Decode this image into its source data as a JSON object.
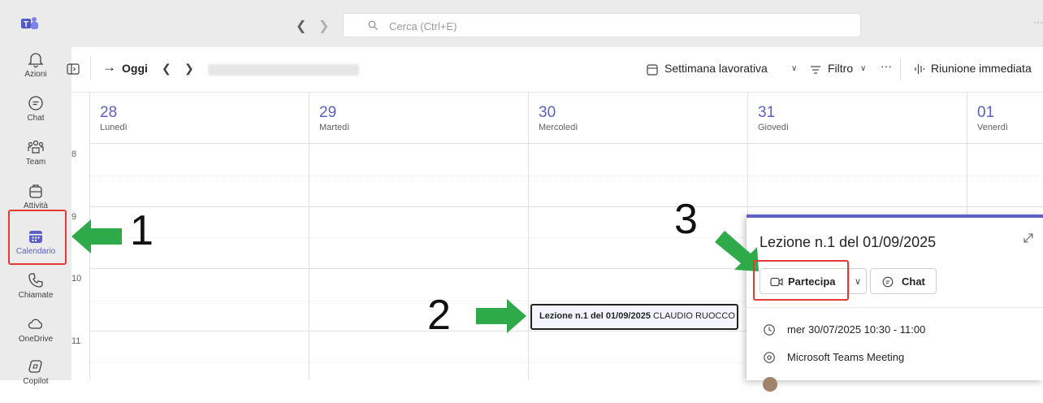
{
  "topbar": {
    "search_placeholder": "Cerca (Ctrl+E)",
    "more": "···"
  },
  "rail": {
    "items": [
      {
        "label": "Azioni",
        "icon": "bell-icon"
      },
      {
        "label": "Chat",
        "icon": "chat-icon"
      },
      {
        "label": "Team",
        "icon": "teams-icon"
      },
      {
        "label": "Attività",
        "icon": "briefcase-icon"
      },
      {
        "label": "Calendario",
        "icon": "calendar-icon",
        "active": true
      },
      {
        "label": "Chiamate",
        "icon": "phone-icon"
      },
      {
        "label": "OneDrive",
        "icon": "cloud-icon"
      },
      {
        "label": "Copilot",
        "icon": "copilot-icon"
      }
    ]
  },
  "toolbar": {
    "today": "Oggi",
    "view": "Settimana lavorativa",
    "filter": "Filtro",
    "more": "···",
    "meet_now": "Riunione immediata"
  },
  "calendar": {
    "days": [
      {
        "num": "28",
        "name": "Lunedì"
      },
      {
        "num": "29",
        "name": "Martedì"
      },
      {
        "num": "30",
        "name": "Mercoledì"
      },
      {
        "num": "31",
        "name": "Giovedì"
      },
      {
        "num": "01",
        "name": "Venerdì"
      }
    ],
    "hours": [
      "8",
      "9",
      "10",
      "11"
    ],
    "event": {
      "title": "Lezione n.1 del 01/09/2025",
      "organizer": "CLAUDIO RUOCCO"
    }
  },
  "popup": {
    "title": "Lezione n.1 del 01/09/2025",
    "join_label": "Partecipa",
    "chat_label": "Chat",
    "datetime": "mer 30/07/2025 10:30 - 11:00",
    "location": "Microsoft Teams Meeting"
  },
  "annotations": {
    "step1": "1",
    "step2": "2",
    "step3": "3",
    "arrow_color": "#2eaa4a",
    "box_color": "#e53935"
  },
  "colors": {
    "accent": "#5b5fc7"
  }
}
